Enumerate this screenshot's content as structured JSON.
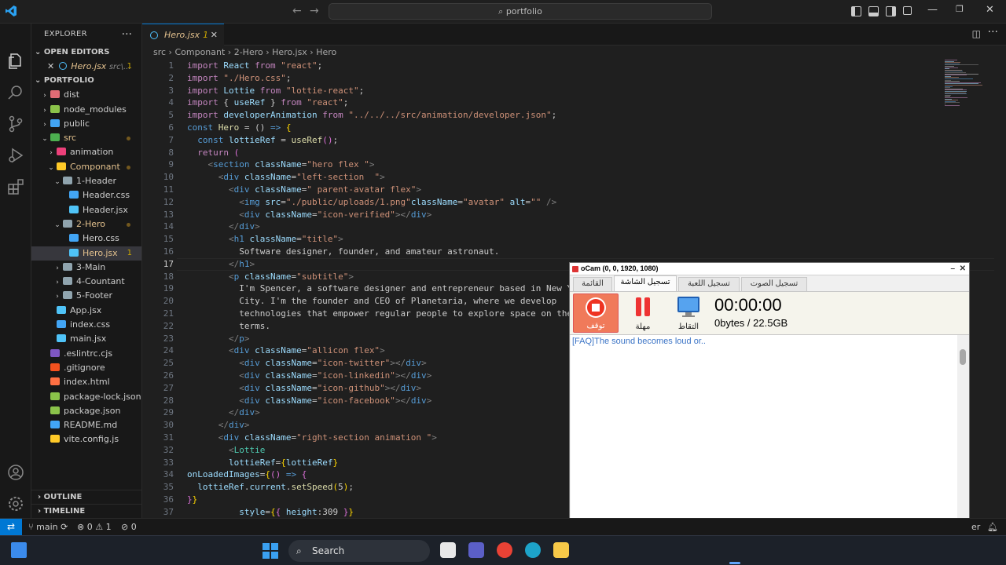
{
  "titlebar": {
    "search_text": "portfolio"
  },
  "sidebar": {
    "title": "EXPLORER",
    "open_editors_label": "OPEN EDITORS",
    "open_editor": {
      "name": "Hero.jsx",
      "path": "src\\...",
      "count": "1"
    },
    "project_label": "PORTFOLIO",
    "items": [
      {
        "label": "dist",
        "indent": 1,
        "kind": "folder",
        "color": "#e06c75"
      },
      {
        "label": "node_modules",
        "indent": 1,
        "kind": "folder",
        "color": "#8bc34a"
      },
      {
        "label": "public",
        "indent": 1,
        "kind": "folder",
        "color": "#42a5f5"
      },
      {
        "label": "src",
        "indent": 1,
        "kind": "folder-open",
        "color": "#4caf50",
        "modified": true
      },
      {
        "label": "animation",
        "indent": 2,
        "kind": "folder",
        "color": "#ec407a"
      },
      {
        "label": "Componant",
        "indent": 2,
        "kind": "folder-open",
        "color": "#ffca28",
        "modified": true
      },
      {
        "label": "1-Header",
        "indent": 3,
        "kind": "folder-open",
        "color": "#90a4ae"
      },
      {
        "label": "Header.css",
        "indent": 4,
        "kind": "file",
        "color": "#42a5f5"
      },
      {
        "label": "Header.jsx",
        "indent": 4,
        "kind": "file",
        "color": "#4fc3f7"
      },
      {
        "label": "2-Hero",
        "indent": 3,
        "kind": "folder-open",
        "color": "#90a4ae",
        "modified": true
      },
      {
        "label": "Hero.css",
        "indent": 4,
        "kind": "file",
        "color": "#42a5f5"
      },
      {
        "label": "Hero.jsx",
        "indent": 4,
        "kind": "file",
        "color": "#4fc3f7",
        "modified": true,
        "selected": true,
        "count": "1"
      },
      {
        "label": "3-Main",
        "indent": 3,
        "kind": "folder",
        "color": "#90a4ae"
      },
      {
        "label": "4-Countant",
        "indent": 3,
        "kind": "folder",
        "color": "#90a4ae"
      },
      {
        "label": "5-Footer",
        "indent": 3,
        "kind": "folder",
        "color": "#90a4ae"
      },
      {
        "label": "App.jsx",
        "indent": 2,
        "kind": "file",
        "color": "#4fc3f7"
      },
      {
        "label": "index.css",
        "indent": 2,
        "kind": "file",
        "color": "#42a5f5"
      },
      {
        "label": "main.jsx",
        "indent": 2,
        "kind": "file",
        "color": "#4fc3f7"
      },
      {
        "label": ".eslintrc.cjs",
        "indent": 1,
        "kind": "file",
        "color": "#7e57c2"
      },
      {
        "label": ".gitignore",
        "indent": 1,
        "kind": "file",
        "color": "#f4511e"
      },
      {
        "label": "index.html",
        "indent": 1,
        "kind": "file",
        "color": "#ff7043"
      },
      {
        "label": "package-lock.json",
        "indent": 1,
        "kind": "file",
        "color": "#8bc34a"
      },
      {
        "label": "package.json",
        "indent": 1,
        "kind": "file",
        "color": "#8bc34a"
      },
      {
        "label": "README.md",
        "indent": 1,
        "kind": "file",
        "color": "#42a5f5"
      },
      {
        "label": "vite.config.js",
        "indent": 1,
        "kind": "file",
        "color": "#ffca28"
      }
    ],
    "outline_label": "OUTLINE",
    "timeline_label": "TIMELINE"
  },
  "editor": {
    "tab": {
      "name": "Hero.jsx",
      "count": "1"
    },
    "breadcrumb": [
      "src",
      "Componant",
      "2-Hero",
      "Hero.jsx",
      "Hero"
    ],
    "current_line": 17,
    "line_numbers": [
      "1",
      "2",
      "3",
      "4",
      "5",
      "6",
      "7",
      "8",
      "9",
      "10",
      "11",
      "12",
      "13",
      "14",
      "15",
      "16",
      "17",
      "18",
      "19",
      "20",
      "21",
      "22",
      "23",
      "24",
      "25",
      "26",
      "27",
      "28",
      "29",
      "30",
      "31",
      "32",
      "33",
      "34",
      "35",
      "36",
      "37"
    ],
    "lines": [
      [
        [
          "k",
          "import "
        ],
        [
          "v",
          "React"
        ],
        [
          "k",
          " from "
        ],
        [
          "s",
          "\"react\""
        ],
        [
          "",
          "; "
        ]
      ],
      [
        [
          "k",
          "import "
        ],
        [
          "s",
          "\"./Hero.css\""
        ],
        [
          "",
          ";"
        ]
      ],
      [
        [
          "k",
          "import "
        ],
        [
          "v",
          "Lottie"
        ],
        [
          "k",
          " from "
        ],
        [
          "s",
          "\"lottie-react\""
        ],
        [
          "",
          ";"
        ]
      ],
      [
        [
          "k",
          "import "
        ],
        [
          "",
          "{ "
        ],
        [
          "v",
          "useRef"
        ],
        [
          "",
          " } "
        ],
        [
          "k",
          "from "
        ],
        [
          "s",
          "\"react\""
        ],
        [
          "",
          ";"
        ]
      ],
      [
        [
          "k",
          "import "
        ],
        [
          "v",
          "developerAnimation"
        ],
        [
          "k",
          " from "
        ],
        [
          "s",
          "\"../../../src/animation/developer.json\""
        ],
        [
          "",
          ";"
        ]
      ],
      [
        [
          "t",
          "const "
        ],
        [
          "f",
          "Hero"
        ],
        [
          "",
          " = () "
        ],
        [
          "t",
          "=>"
        ],
        [
          "",
          " "
        ],
        [
          "y",
          "{"
        ]
      ],
      [
        [
          "",
          "  "
        ],
        [
          "t",
          "const "
        ],
        [
          "v",
          "lottieRef"
        ],
        [
          "",
          " = "
        ],
        [
          "f",
          "useRef"
        ],
        [
          "b",
          "()"
        ],
        [
          "",
          ";"
        ]
      ],
      [
        [
          "",
          "  "
        ],
        [
          "k",
          "return "
        ],
        [
          "b",
          "("
        ]
      ],
      [
        [
          "",
          "    "
        ],
        [
          "p",
          "<"
        ],
        [
          "t",
          "section "
        ],
        [
          "v",
          "className"
        ],
        [
          "",
          "="
        ],
        [
          "s",
          "\"hero flex \""
        ],
        [
          "p",
          ">"
        ]
      ],
      [
        [
          "",
          "      "
        ],
        [
          "p",
          "<"
        ],
        [
          "t",
          "div "
        ],
        [
          "v",
          "className"
        ],
        [
          "",
          "="
        ],
        [
          "s",
          "\"left-section  \""
        ],
        [
          "p",
          ">"
        ]
      ],
      [
        [
          "",
          "        "
        ],
        [
          "p",
          "<"
        ],
        [
          "t",
          "div "
        ],
        [
          "v",
          "className"
        ],
        [
          "",
          "="
        ],
        [
          "s",
          "\" parent-avatar flex\""
        ],
        [
          "p",
          ">"
        ]
      ],
      [
        [
          "",
          "          "
        ],
        [
          "p",
          "<"
        ],
        [
          "t",
          "img "
        ],
        [
          "v",
          "src"
        ],
        [
          "",
          "="
        ],
        [
          "s",
          "\"./public/uploads/1.png\""
        ],
        [
          "",
          "",
          " "
        ],
        [
          "v",
          "className"
        ],
        [
          "",
          "="
        ],
        [
          "s",
          "\"avatar\""
        ],
        [
          "",
          " "
        ],
        [
          "v",
          "alt"
        ],
        [
          "",
          "="
        ],
        [
          "s",
          "\"\""
        ],
        [
          "",
          " "
        ],
        [
          "p",
          "/>"
        ]
      ],
      [
        [
          "",
          "          "
        ],
        [
          "p",
          "<"
        ],
        [
          "t",
          "div "
        ],
        [
          "v",
          "className"
        ],
        [
          "",
          "="
        ],
        [
          "s",
          "\"icon-verified\""
        ],
        [
          "p",
          "></"
        ],
        [
          "t",
          "div"
        ],
        [
          "p",
          ">"
        ]
      ],
      [
        [
          "",
          "        "
        ],
        [
          "p",
          "</"
        ],
        [
          "t",
          "div"
        ],
        [
          "p",
          ">"
        ]
      ],
      [
        [
          "",
          "        "
        ],
        [
          "p",
          "<"
        ],
        [
          "t",
          "h1 "
        ],
        [
          "v",
          "className"
        ],
        [
          "",
          "="
        ],
        [
          "s",
          "\"title\""
        ],
        [
          "p",
          ">"
        ]
      ],
      [
        [
          "",
          "          Software designer, founder, and amateur astronaut."
        ]
      ],
      [
        [
          "",
          "        "
        ],
        [
          "p",
          "</"
        ],
        [
          "t",
          "h1"
        ],
        [
          "p",
          ">"
        ]
      ],
      [
        [
          "",
          "        "
        ],
        [
          "p",
          "<"
        ],
        [
          "t",
          "p "
        ],
        [
          "v",
          "className"
        ],
        [
          "",
          "="
        ],
        [
          "s",
          "\"subtitle\""
        ],
        [
          "p",
          ">"
        ]
      ],
      [
        [
          "",
          "          I'm Spencer, a software designer and entrepreneur based in New York"
        ]
      ],
      [
        [
          "",
          "          City. I'm the founder and CEO of Planetaria, where we develop"
        ]
      ],
      [
        [
          "",
          "          technologies that empower regular people to explore space on their own"
        ]
      ],
      [
        [
          "",
          "          terms."
        ]
      ],
      [
        [
          "",
          "        "
        ],
        [
          "p",
          "</"
        ],
        [
          "t",
          "p"
        ],
        [
          "p",
          ">"
        ]
      ],
      [
        [
          "",
          "        "
        ],
        [
          "p",
          "<"
        ],
        [
          "t",
          "div "
        ],
        [
          "v",
          "className"
        ],
        [
          "",
          "="
        ],
        [
          "s",
          "\"allicon flex\""
        ],
        [
          "p",
          ">"
        ]
      ],
      [
        [
          "",
          "          "
        ],
        [
          "p",
          "<"
        ],
        [
          "t",
          "div "
        ],
        [
          "v",
          "className"
        ],
        [
          "",
          "="
        ],
        [
          "s",
          "\"icon-twitter\""
        ],
        [
          "p",
          "></"
        ],
        [
          "t",
          "div"
        ],
        [
          "p",
          ">"
        ]
      ],
      [
        [
          "",
          "          "
        ],
        [
          "p",
          "<"
        ],
        [
          "t",
          "div "
        ],
        [
          "v",
          "className"
        ],
        [
          "",
          "="
        ],
        [
          "s",
          "\"icon-linkedin\""
        ],
        [
          "p",
          "></"
        ],
        [
          "t",
          "div"
        ],
        [
          "p",
          ">"
        ]
      ],
      [
        [
          "",
          "          "
        ],
        [
          "p",
          "<"
        ],
        [
          "t",
          "div "
        ],
        [
          "v",
          "className"
        ],
        [
          "",
          "="
        ],
        [
          "s",
          "\"icon-github\""
        ],
        [
          "p",
          "></"
        ],
        [
          "t",
          "div"
        ],
        [
          "p",
          ">"
        ]
      ],
      [
        [
          "",
          "          "
        ],
        [
          "p",
          "<"
        ],
        [
          "t",
          "div "
        ],
        [
          "v",
          "className"
        ],
        [
          "",
          "="
        ],
        [
          "s",
          "\"icon-facebook\""
        ],
        [
          "p",
          "></"
        ],
        [
          "t",
          "div"
        ],
        [
          "p",
          ">"
        ]
      ],
      [
        [
          "",
          "        "
        ],
        [
          "p",
          "</"
        ],
        [
          "t",
          "div"
        ],
        [
          "p",
          ">"
        ]
      ],
      [
        [
          "",
          "      "
        ],
        [
          "p",
          "</"
        ],
        [
          "t",
          "div"
        ],
        [
          "p",
          ">"
        ]
      ],
      [
        [
          "",
          "      "
        ],
        [
          "p",
          "<"
        ],
        [
          "t",
          "div "
        ],
        [
          "v",
          "className"
        ],
        [
          "",
          "="
        ],
        [
          "s",
          "\"right-section animation \""
        ],
        [
          "p",
          ">"
        ]
      ],
      [
        [
          "",
          "        "
        ],
        [
          "p",
          "<"
        ],
        [
          "c",
          "Lottie"
        ]
      ],
      [
        [
          "",
          "        "
        ],
        [
          "v",
          "lottieRef"
        ],
        [
          "",
          "="
        ],
        [
          "y",
          "{"
        ],
        [
          "v",
          "lottieRef"
        ],
        [
          "y",
          "}"
        ]
      ],
      [
        [
          "v",
          "onLoadedImages"
        ],
        [
          "",
          "="
        ],
        [
          "y",
          "{"
        ],
        [
          "b",
          "()"
        ],
        [
          "",
          " "
        ],
        [
          "t",
          "=>"
        ],
        [
          "",
          " "
        ],
        [
          "b",
          "{"
        ]
      ],
      [
        [
          "",
          "  "
        ],
        [
          "v",
          "lottieRef"
        ],
        [
          "",
          "."
        ],
        [
          "v",
          "current"
        ],
        [
          "",
          "."
        ],
        [
          "f",
          "setSpeed"
        ],
        [
          "y",
          "("
        ],
        [
          "",
          "5"
        ],
        [
          "y",
          ")"
        ],
        [
          "",
          ";"
        ]
      ],
      [
        [
          "b",
          "}"
        ],
        [
          "y",
          "}"
        ]
      ],
      [
        [
          "",
          "          "
        ],
        [
          "v",
          "style"
        ],
        [
          "",
          "="
        ],
        [
          "y",
          "{"
        ],
        [
          "b",
          "{"
        ],
        [
          "",
          " "
        ],
        [
          "v",
          "height"
        ],
        [
          "",
          ":309 "
        ],
        [
          "b",
          "}"
        ],
        [
          "y",
          "}"
        ]
      ]
    ]
  },
  "statusbar": {
    "branch": "main",
    "errors": "0",
    "warnings": "1",
    "ports": "0",
    "right_text": "er"
  },
  "taskbar": {
    "search_label": "Search"
  },
  "ocam": {
    "title": "oCam (0, 0, 1920, 1080)",
    "tabs": [
      "القائمة",
      "تسجيل الشاشة",
      "تسجيل اللعبة",
      "تسجيل الصوت"
    ],
    "active_tab": 1,
    "stop_label": "توقف",
    "pause_label": "مهلة",
    "capture_label": "التقاط",
    "timer": "00:00:00",
    "size": "0bytes / 22.5GB",
    "faq": "[FAQ]The sound becomes loud or.."
  }
}
